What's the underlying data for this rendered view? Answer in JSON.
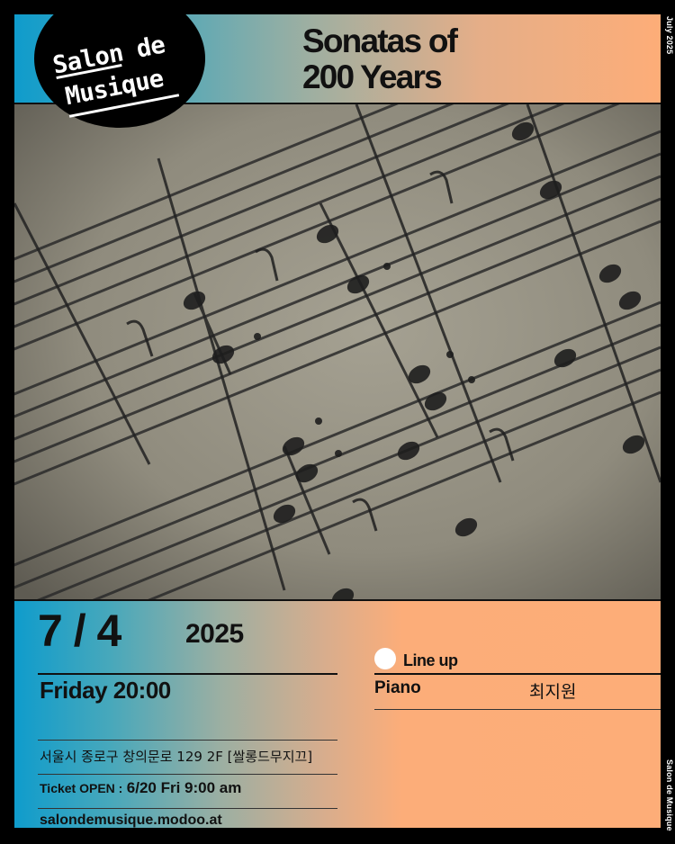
{
  "brand": {
    "line1": "Salon de",
    "line2": "Musique"
  },
  "title": {
    "line1": "Sonatas of",
    "line2": "200 Years"
  },
  "side": {
    "top": "July 2025",
    "bottom": "Salon de Musique"
  },
  "event": {
    "date": "7 / 4",
    "year": "2025",
    "day_time": "Friday 20:00",
    "address": "서울시 종로구 창의문로 129 2F [쌀롱드무지끄]",
    "ticket_label": "Ticket OPEN :",
    "ticket_value": "6/20 Fri  9:00 am",
    "website": "salondemusique.modoo.at"
  },
  "lineup": {
    "heading": "Line up",
    "performers": [
      {
        "instrument": "Piano",
        "name": "최지원"
      }
    ]
  },
  "colors": {
    "accent_blue": "#0f9ccc",
    "accent_orange": "#fdad78",
    "frame": "#000000"
  },
  "photo": {
    "subject": "sheet-music-photo"
  }
}
